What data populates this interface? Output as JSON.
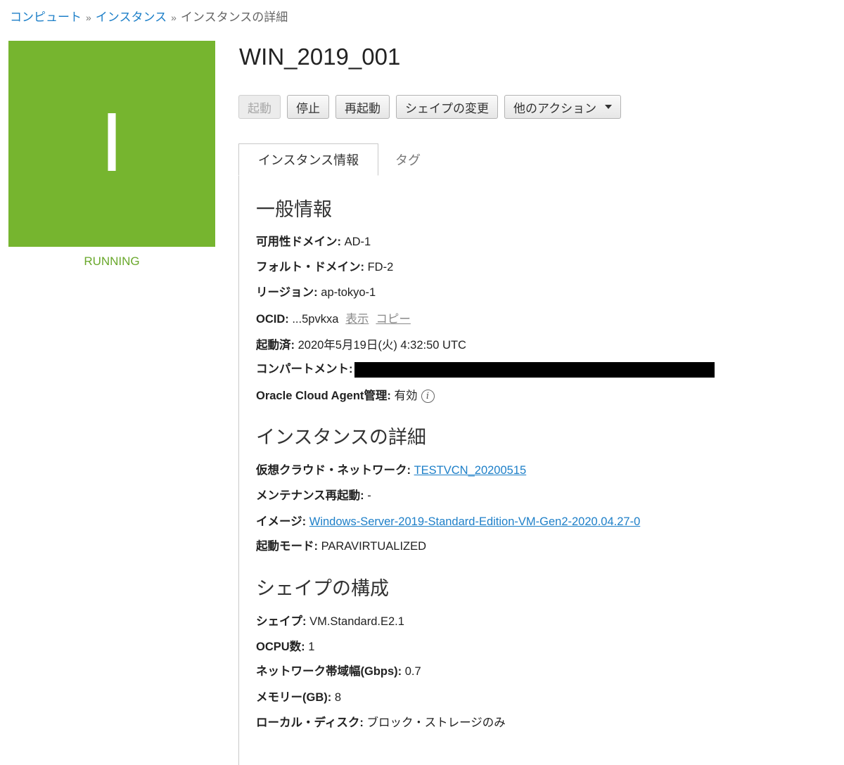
{
  "breadcrumb": {
    "items": [
      "コンピュート",
      "インスタンス"
    ],
    "separator": "»",
    "current": "インスタンスの詳細"
  },
  "instance": {
    "tile_letter": "I",
    "tile_color": "#76b52f",
    "status": "RUNNING",
    "name": "WIN_2019_001"
  },
  "actions": {
    "start": "起動",
    "stop": "停止",
    "restart": "再起動",
    "change_shape": "シェイプの変更",
    "more_actions": "他のアクション"
  },
  "tabs": {
    "info": "インスタンス情報",
    "tags": "タグ"
  },
  "general": {
    "title": "一般情報",
    "ad_label": "可用性ドメイン:",
    "ad_value": "AD-1",
    "fd_label": "フォルト・ドメイン:",
    "fd_value": "FD-2",
    "region_label": "リージョン:",
    "region_value": "ap-tokyo-1",
    "ocid_label": "OCID:",
    "ocid_value": "...5pvkxa",
    "ocid_show": "表示",
    "ocid_copy": "コピー",
    "launched_label": "起動済:",
    "launched_value": "2020年5月19日(火) 4:32:50 UTC",
    "compartment_label": "コンパートメント:",
    "agent_label": "Oracle Cloud Agent管理:",
    "agent_value": "有効",
    "info_icon": "i"
  },
  "details": {
    "title": "インスタンスの詳細",
    "vcn_label": "仮想クラウド・ネットワーク:",
    "vcn_value": "TESTVCN_20200515",
    "maint_label": "メンテナンス再起動:",
    "maint_value": "-",
    "image_label": "イメージ:",
    "image_value": "Windows-Server-2019-Standard-Edition-VM-Gen2-2020.04.27-0",
    "mode_label": "起動モード:",
    "mode_value": "PARAVIRTUALIZED"
  },
  "shape": {
    "title": "シェイプの構成",
    "shape_label": "シェイプ:",
    "shape_value": "VM.Standard.E2.1",
    "ocpu_label": "OCPU数:",
    "ocpu_value": "1",
    "bandwidth_label": "ネットワーク帯域幅(Gbps):",
    "bandwidth_value": "0.7",
    "memory_label": "メモリー(GB):",
    "memory_value": "8",
    "disk_label": "ローカル・ディスク:",
    "disk_value": "ブロック・ストレージのみ"
  }
}
